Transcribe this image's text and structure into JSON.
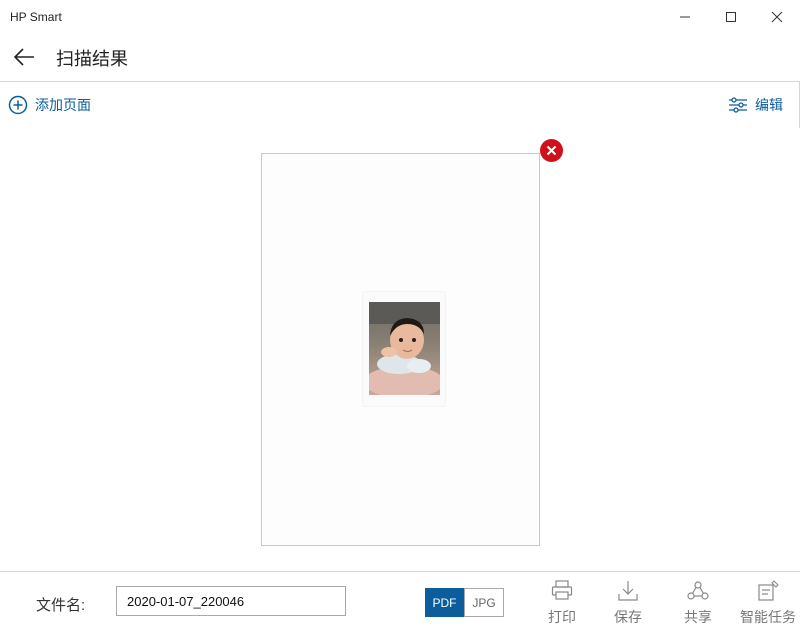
{
  "window": {
    "app_title": "HP Smart",
    "minimize_icon": "minimize-icon",
    "maximize_icon": "maximize-icon",
    "close_icon": "close-icon"
  },
  "header": {
    "back_icon": "arrow-left-icon",
    "title": "扫描结果"
  },
  "commandbar": {
    "add_page_label": "添加页面",
    "add_page_icon": "plus-circle-icon",
    "edit_label": "编辑",
    "edit_icon": "sliders-icon"
  },
  "preview": {
    "delete_icon": "delete-x-icon",
    "photo_description_icon": "scanned-photo"
  },
  "footer": {
    "filename_label": "文件名:",
    "filename_value": "2020-01-07_220046",
    "formats": [
      "PDF",
      "JPG"
    ],
    "selected_format": "PDF",
    "actions": [
      {
        "label": "打印",
        "icon": "printer-icon"
      },
      {
        "label": "保存",
        "icon": "save-download-icon"
      },
      {
        "label": "共享",
        "icon": "share-icon"
      },
      {
        "label": "智能任务",
        "icon": "smart-task-icon"
      }
    ]
  },
  "colors": {
    "accent": "#0b5d9b",
    "delete": "#d0101b",
    "border": "#d6d6d6"
  }
}
